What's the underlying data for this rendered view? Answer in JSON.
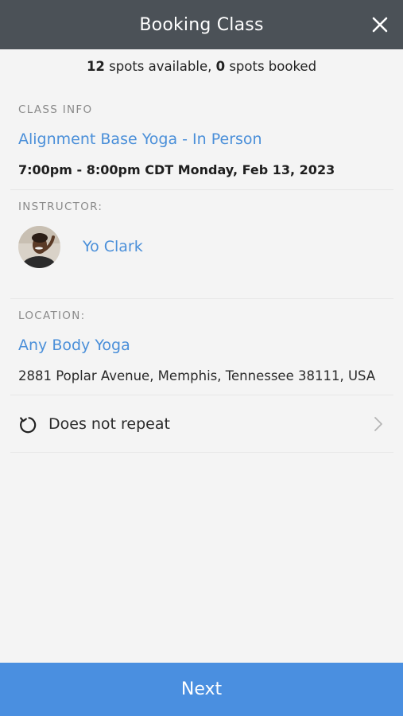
{
  "header": {
    "title": "Booking Class",
    "close_icon": "close-icon"
  },
  "availability": {
    "spots_available": "12",
    "spots_available_text": " spots available, ",
    "spots_booked": "0",
    "spots_booked_text": " spots booked"
  },
  "class_info": {
    "label": "CLASS INFO",
    "name": "Alignment Base Yoga - In Person",
    "datetime": "7:00pm - 8:00pm CDT Monday, Feb 13, 2023"
  },
  "instructor": {
    "label": "INSTRUCTOR:",
    "name": "Yo Clark",
    "avatar_icon": "instructor-avatar"
  },
  "location": {
    "label": "LOCATION:",
    "name": "Any Body Yoga",
    "address": "2881 Poplar Avenue, Memphis, Tennessee 38111, USA"
  },
  "repeat": {
    "label": "Does not repeat",
    "icon": "repeat-icon",
    "chevron": "chevron-right-icon"
  },
  "footer": {
    "next_label": "Next"
  },
  "colors": {
    "header_bg": "#4b5157",
    "accent": "#4a8fd9",
    "button_bg": "#4a8fe0",
    "page_bg": "#f4f4f4"
  }
}
